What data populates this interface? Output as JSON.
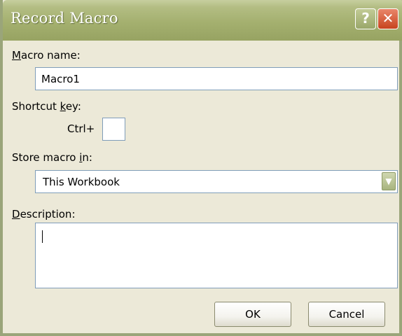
{
  "window": {
    "title": "Record Macro",
    "help_glyph": "?",
    "close_glyph": "✕"
  },
  "macro_name": {
    "label_pre": "",
    "label_key": "M",
    "label_post": "acro name:",
    "value": "Macro1"
  },
  "shortcut": {
    "label_pre": "Shortcut ",
    "label_key": "k",
    "label_post": "ey:",
    "prefix": "Ctrl+",
    "value": ""
  },
  "store": {
    "label_pre": "Store macro ",
    "label_key": "i",
    "label_post": "n:",
    "selected": "This Workbook",
    "arrow_icon": "chevron-down-icon"
  },
  "description": {
    "label_pre": "",
    "label_key": "D",
    "label_post": "escription:",
    "value": ""
  },
  "buttons": {
    "ok": "OK",
    "cancel": "Cancel"
  }
}
